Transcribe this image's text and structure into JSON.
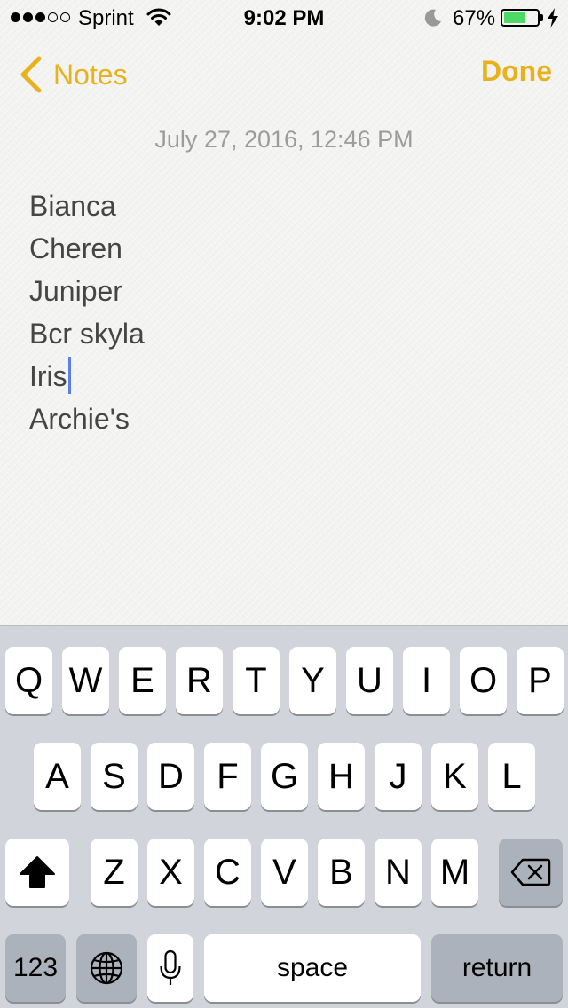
{
  "status_bar": {
    "carrier": "Sprint",
    "signal_bars_filled": 3,
    "signal_bars_total": 5,
    "time": "9:02 PM",
    "battery_percent": "67%",
    "battery_level": 0.67,
    "icons": [
      "wifi-icon",
      "moon-icon",
      "battery-icon",
      "charging-bolt-icon"
    ],
    "battery_color": "#4cd964"
  },
  "nav": {
    "back_label": "Notes",
    "done_label": "Done",
    "accent_color": "#e8b21e"
  },
  "note": {
    "date": "July 27, 2016, 12:46 PM",
    "lines": [
      "Bianca",
      "Cheren",
      "Juniper",
      "Bcr skyla",
      "Iris",
      "Archie's"
    ],
    "caret_after_line": 4
  },
  "keyboard": {
    "row1": [
      "Q",
      "W",
      "E",
      "R",
      "T",
      "Y",
      "U",
      "I",
      "O",
      "P"
    ],
    "row2": [
      "A",
      "S",
      "D",
      "F",
      "G",
      "H",
      "J",
      "K",
      "L"
    ],
    "row3": [
      "Z",
      "X",
      "C",
      "V",
      "B",
      "N",
      "M"
    ],
    "numbers_label": "123",
    "space_label": "space",
    "return_label": "return",
    "icons": [
      "shift-icon",
      "backspace-icon",
      "globe-icon",
      "microphone-icon"
    ]
  }
}
